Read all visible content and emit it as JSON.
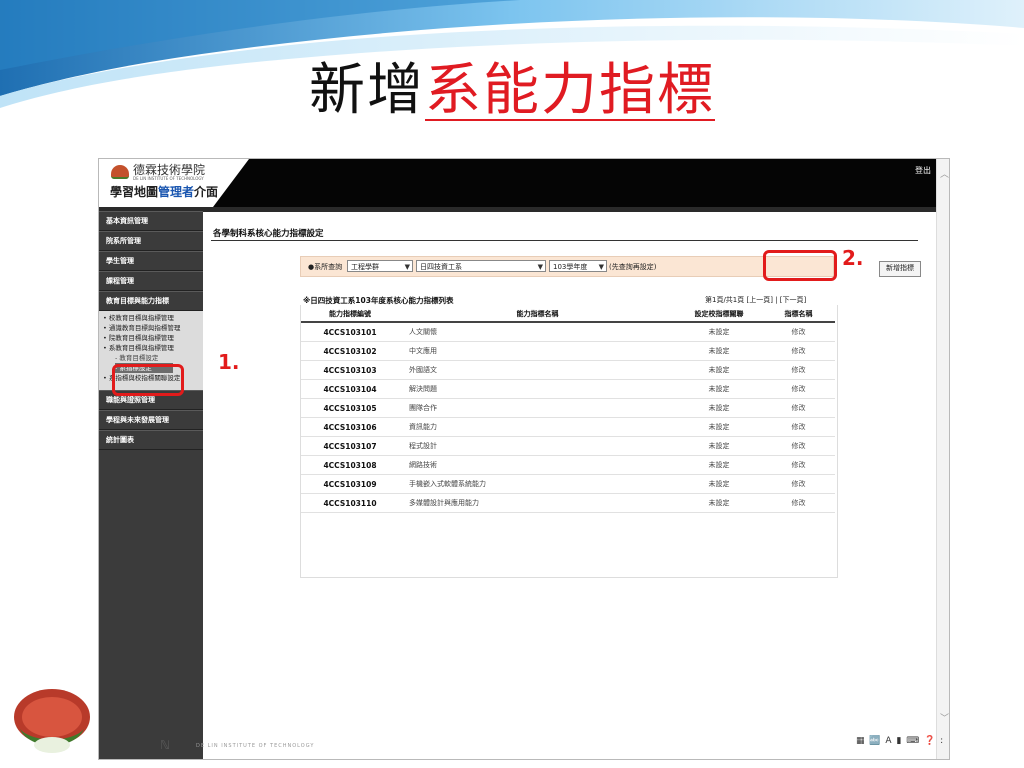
{
  "slide": {
    "title_prefix": "新增",
    "title_highlight": "系能力指標",
    "callout_1": "1.",
    "callout_2": "2."
  },
  "app": {
    "logo_school": "德霖技術學院",
    "logo_en": "DE LIN INSTITUTE OF TECHNOLOGY",
    "logo_system_prefix": "學習地圖",
    "logo_system_highlight": "管理者",
    "logo_system_suffix": "介面",
    "logout": "登出"
  },
  "sidebar": {
    "items": [
      {
        "label": "基本資訊管理"
      },
      {
        "label": "院系所管理"
      },
      {
        "label": "學生管理"
      },
      {
        "label": "課程管理"
      },
      {
        "label": "教育目標與能力指標"
      }
    ],
    "sub_items": [
      {
        "label": "• 校教育目標與指標管理"
      },
      {
        "label": "• 通識教育目標與指標管理"
      },
      {
        "label": "• 院教育目標與指標管理"
      },
      {
        "label": "• 系教育目標與指標管理"
      }
    ],
    "sub_sub_items": [
      {
        "label": "- 教育目標設定"
      },
      {
        "label": "- 系指標設定"
      }
    ],
    "sub_item_last": "• 系指標與校指標關聯設定",
    "items_after": [
      {
        "label": "職能與證照管理"
      },
      {
        "label": "學程與未來發展管理"
      },
      {
        "label": "統計圖表"
      }
    ]
  },
  "main": {
    "page_title": "各學制科系核心能力指標設定",
    "filter_label": "●系所查詢",
    "select_college": "工程學群",
    "select_dept": "日四技資工系",
    "select_year": "103學年度",
    "filter_note": "(先查詢再設定)",
    "add_button": "新增指標",
    "list_title": "※日四技資工系103年度系核心能力指標列表",
    "pager_info": "第1頁/共1頁",
    "pager_prev": "[上一頁]",
    "pager_sep": "|",
    "pager_next": "[下一頁]",
    "columns": [
      "能力指標編號",
      "能力指標名稱",
      "設定校指標關聯",
      "指標名稱"
    ],
    "rows": [
      {
        "code": "4CCS103101",
        "name": "人文關懷",
        "link": "未設定",
        "action": "修改"
      },
      {
        "code": "4CCS103102",
        "name": "中文應用",
        "link": "未設定",
        "action": "修改"
      },
      {
        "code": "4CCS103103",
        "name": "外國語文",
        "link": "未設定",
        "action": "修改"
      },
      {
        "code": "4CCS103104",
        "name": "解決問題",
        "link": "未設定",
        "action": "修改"
      },
      {
        "code": "4CCS103105",
        "name": "團隊合作",
        "link": "未設定",
        "action": "修改"
      },
      {
        "code": "4CCS103106",
        "name": "資訊能力",
        "link": "未設定",
        "action": "修改"
      },
      {
        "code": "4CCS103107",
        "name": "程式設計",
        "link": "未設定",
        "action": "修改"
      },
      {
        "code": "4CCS103108",
        "name": "網路技術",
        "link": "未設定",
        "action": "修改"
      },
      {
        "code": "4CCS103109",
        "name": "手機嵌入式軟體系統能力",
        "link": "未設定",
        "action": "修改"
      },
      {
        "code": "4CCS103110",
        "name": "多媒體設計與應用能力",
        "link": "未設定",
        "action": "修改"
      }
    ]
  },
  "footer": {
    "seal_text": "德霖技術學院",
    "institute": "DE LIN INSTITUTE OF TECHNOLOGY",
    "taskbar": "▦ 🔤 A ▮ ⌨ ❓ :"
  },
  "colors": {
    "accent_red": "#e21b1b",
    "title_red": "#e01b22",
    "filter_bg": "#fbe6d4",
    "topbar": "#050505",
    "sidebar": "#3b3b3b"
  }
}
